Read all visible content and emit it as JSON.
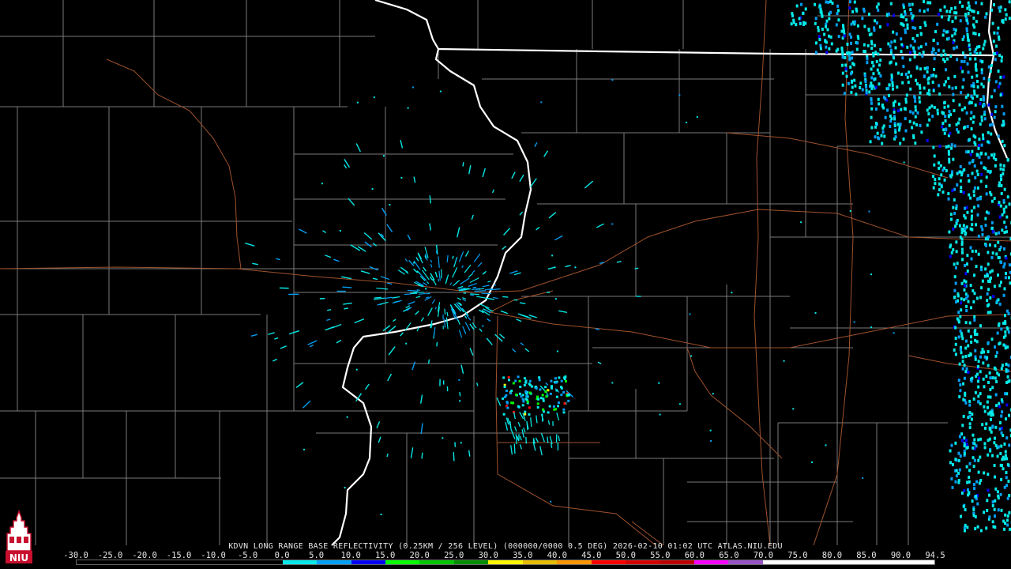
{
  "caption": "KDVN LONG RANGE BASE REFLECTIVITY (0.25KM / 256 LEVEL) (000000/0000 0.5 DEG) 2026-02-10 01:02 UTC  ATLAS.NIU.EDU",
  "legend": {
    "ticks": [
      "-30.0",
      "-25.0",
      "-20.0",
      "-15.0",
      "-10.0",
      "-5.0",
      "0.0",
      "5.0",
      "10.0",
      "15.0",
      "20.0",
      "25.0",
      "30.0",
      "35.0",
      "40.0",
      "45.0",
      "50.0",
      "55.0",
      "60.0",
      "65.0",
      "70.0",
      "75.0",
      "80.0",
      "85.0",
      "90.0",
      "94.5"
    ],
    "colors": [
      "#000000",
      "#000000",
      "#000000",
      "#000000",
      "#000000",
      "#000000",
      "#04e9e7",
      "#019ff4",
      "#0300f4",
      "#02fd02",
      "#01c501",
      "#008e00",
      "#fdf802",
      "#e5bc00",
      "#fd9500",
      "#fd0000",
      "#d40000",
      "#bc0000",
      "#f800fd",
      "#9854c6",
      "#fdfdfd",
      "#ffffff",
      "#ffffff",
      "#ffffff",
      "#ffffff"
    ]
  },
  "logo": {
    "text": "NIU",
    "icon": "niu-tower-logo"
  },
  "colors": {
    "background": "#000000",
    "county_lines": "#7a7a7a",
    "state_lines": "#ffffff",
    "highways": "#a0522d",
    "echo_light": "#04e9e7",
    "echo_medium": "#019ff4",
    "echo_heavy": "#0300f4"
  }
}
